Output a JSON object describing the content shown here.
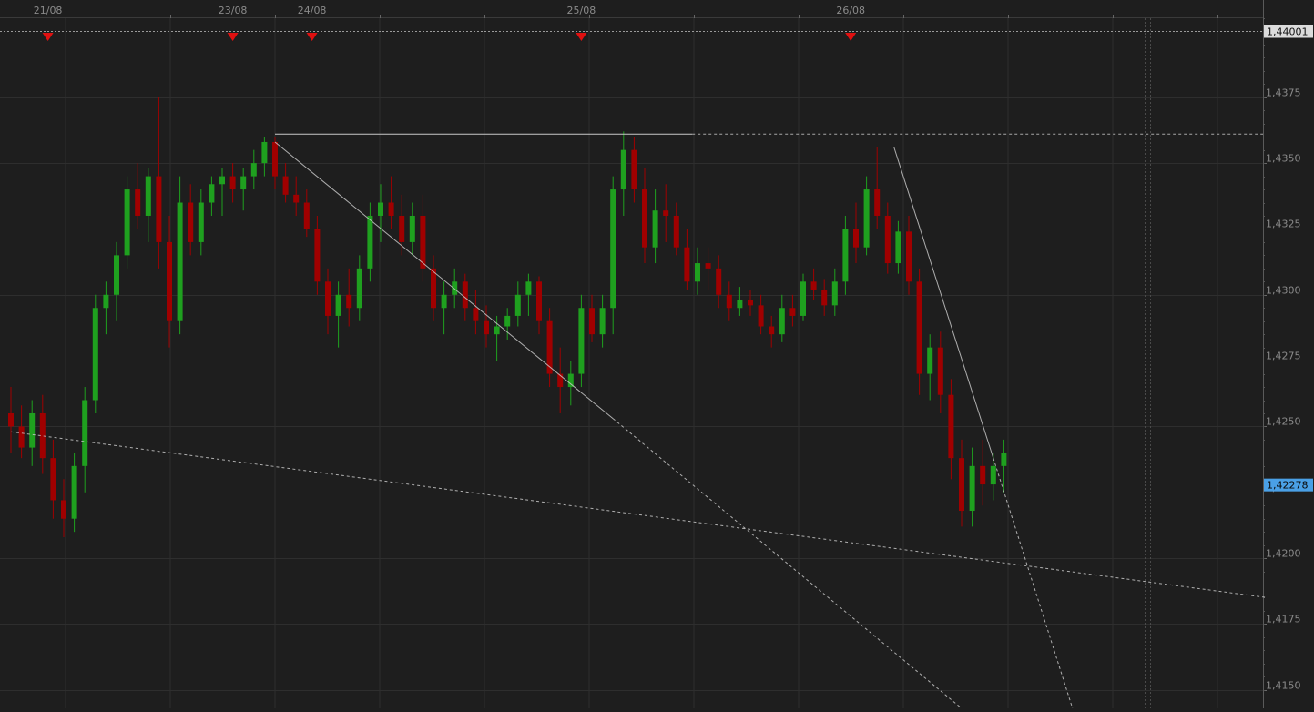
{
  "colors": {
    "background": "#1e1e1e",
    "grid": "#2e2e2e",
    "axis_text": "#8a8a8a",
    "bull_candle": "#1fa01f",
    "bear_candle": "#a00000",
    "trendline": "#c8c8c8",
    "marker": "#e01010",
    "current_price_bg": "#4aa0e6",
    "top_price_bg": "#dcdcdc"
  },
  "chart_data": {
    "type": "candlestick",
    "ylim": [
      1.4143,
      1.4405
    ],
    "xlim": [
      0,
      119
    ],
    "grid": true,
    "y_ticks": [
      {
        "value": 1.4375,
        "label": "1,4375"
      },
      {
        "value": 1.435,
        "label": "1,4350"
      },
      {
        "value": 1.4325,
        "label": "1,4325"
      },
      {
        "value": 1.43,
        "label": "1,4300"
      },
      {
        "value": 1.4275,
        "label": "1,4275"
      },
      {
        "value": 1.425,
        "label": "1,4250"
      },
      {
        "value": 1.4225,
        "label": "1,4225"
      },
      {
        "value": 1.42,
        "label": "1,4200"
      },
      {
        "value": 1.4175,
        "label": "1,4175"
      },
      {
        "value": 1.415,
        "label": "1,4150"
      }
    ],
    "x_ticks": [
      {
        "index": 3.5,
        "label": "21/08"
      },
      {
        "index": 21,
        "label": "23/08"
      },
      {
        "index": 28.5,
        "label": "24/08"
      },
      {
        "index": 54,
        "label": "25/08"
      },
      {
        "index": 79.5,
        "label": "26/08"
      }
    ],
    "markers": [
      3.5,
      21,
      28.5,
      54,
      79.5
    ],
    "top_price": {
      "value": 1.44001,
      "label": "1,44001"
    },
    "current_price": {
      "value": 1.42278,
      "label": "1,42278"
    },
    "resistance": {
      "value": 1.4361,
      "from": 25,
      "solid_to": 64.5
    },
    "trendlines": [
      {
        "style": "dashed",
        "points": [
          [
            0,
            1.4248
          ],
          [
            119,
            1.4185
          ]
        ]
      },
      {
        "style": "solid",
        "points": [
          [
            25,
            1.4358
          ],
          [
            57,
            1.4253
          ]
        ]
      },
      {
        "style": "dashed",
        "points": [
          [
            57,
            1.4253
          ],
          [
            90,
            1.4143
          ]
        ]
      },
      {
        "style": "solid",
        "points": [
          [
            83.6,
            1.4356
          ],
          [
            93,
            1.4238
          ]
        ]
      },
      {
        "style": "dashed",
        "points": [
          [
            93,
            1.4238
          ],
          [
            100.5,
            1.4143
          ]
        ]
      }
    ],
    "candles": [
      [
        1.4255,
        1.4265,
        1.424,
        1.425
      ],
      [
        1.425,
        1.4258,
        1.4238,
        1.4242
      ],
      [
        1.4242,
        1.426,
        1.4235,
        1.4255
      ],
      [
        1.4255,
        1.4262,
        1.4232,
        1.4238
      ],
      [
        1.4238,
        1.4245,
        1.4215,
        1.4222
      ],
      [
        1.4222,
        1.423,
        1.4208,
        1.4215
      ],
      [
        1.4215,
        1.424,
        1.421,
        1.4235
      ],
      [
        1.4235,
        1.4265,
        1.4225,
        1.426
      ],
      [
        1.426,
        1.43,
        1.4255,
        1.4295
      ],
      [
        1.4295,
        1.4305,
        1.4285,
        1.43
      ],
      [
        1.43,
        1.432,
        1.429,
        1.4315
      ],
      [
        1.4315,
        1.4345,
        1.431,
        1.434
      ],
      [
        1.434,
        1.435,
        1.4325,
        1.433
      ],
      [
        1.433,
        1.4348,
        1.432,
        1.4345
      ],
      [
        1.4345,
        1.4375,
        1.431,
        1.432
      ],
      [
        1.432,
        1.433,
        1.428,
        1.429
      ],
      [
        1.429,
        1.4345,
        1.4285,
        1.4335
      ],
      [
        1.4335,
        1.4342,
        1.4315,
        1.432
      ],
      [
        1.432,
        1.434,
        1.4315,
        1.4335
      ],
      [
        1.4335,
        1.4345,
        1.433,
        1.4342
      ],
      [
        1.4342,
        1.4348,
        1.433,
        1.4345
      ],
      [
        1.4345,
        1.435,
        1.4335,
        1.434
      ],
      [
        1.434,
        1.4348,
        1.4332,
        1.4345
      ],
      [
        1.4345,
        1.4355,
        1.434,
        1.435
      ],
      [
        1.435,
        1.436,
        1.4345,
        1.4358
      ],
      [
        1.4358,
        1.436,
        1.434,
        1.4345
      ],
      [
        1.4345,
        1.435,
        1.4335,
        1.4338
      ],
      [
        1.4338,
        1.4345,
        1.433,
        1.4335
      ],
      [
        1.4335,
        1.434,
        1.4322,
        1.4325
      ],
      [
        1.4325,
        1.433,
        1.43,
        1.4305
      ],
      [
        1.4305,
        1.431,
        1.4285,
        1.4292
      ],
      [
        1.4292,
        1.4305,
        1.428,
        1.43
      ],
      [
        1.43,
        1.431,
        1.4288,
        1.4295
      ],
      [
        1.4295,
        1.4315,
        1.429,
        1.431
      ],
      [
        1.431,
        1.4335,
        1.4305,
        1.433
      ],
      [
        1.433,
        1.4342,
        1.432,
        1.4335
      ],
      [
        1.4335,
        1.4345,
        1.4325,
        1.433
      ],
      [
        1.433,
        1.4338,
        1.4315,
        1.432
      ],
      [
        1.432,
        1.4335,
        1.4315,
        1.433
      ],
      [
        1.433,
        1.4338,
        1.4305,
        1.431
      ],
      [
        1.431,
        1.4315,
        1.429,
        1.4295
      ],
      [
        1.4295,
        1.4305,
        1.4285,
        1.43
      ],
      [
        1.43,
        1.431,
        1.4295,
        1.4305
      ],
      [
        1.4305,
        1.4308,
        1.429,
        1.4295
      ],
      [
        1.4295,
        1.4302,
        1.4285,
        1.429
      ],
      [
        1.429,
        1.4296,
        1.428,
        1.4285
      ],
      [
        1.4285,
        1.4292,
        1.4275,
        1.4288
      ],
      [
        1.4288,
        1.4295,
        1.4283,
        1.4292
      ],
      [
        1.4292,
        1.4305,
        1.4288,
        1.43
      ],
      [
        1.43,
        1.4308,
        1.4292,
        1.4305
      ],
      [
        1.4305,
        1.4307,
        1.4285,
        1.429
      ],
      [
        1.429,
        1.4295,
        1.4265,
        1.427
      ],
      [
        1.427,
        1.428,
        1.4255,
        1.4265
      ],
      [
        1.4265,
        1.4275,
        1.4258,
        1.427
      ],
      [
        1.427,
        1.43,
        1.4265,
        1.4295
      ],
      [
        1.4295,
        1.43,
        1.4282,
        1.4285
      ],
      [
        1.4285,
        1.43,
        1.428,
        1.4295
      ],
      [
        1.4295,
        1.4345,
        1.4285,
        1.434
      ],
      [
        1.434,
        1.4362,
        1.433,
        1.4355
      ],
      [
        1.4355,
        1.436,
        1.4335,
        1.434
      ],
      [
        1.434,
        1.4348,
        1.4312,
        1.4318
      ],
      [
        1.4318,
        1.434,
        1.4312,
        1.4332
      ],
      [
        1.4332,
        1.4342,
        1.432,
        1.433
      ],
      [
        1.433,
        1.4335,
        1.4315,
        1.4318
      ],
      [
        1.4318,
        1.4325,
        1.4302,
        1.4305
      ],
      [
        1.4305,
        1.4318,
        1.43,
        1.4312
      ],
      [
        1.4312,
        1.4318,
        1.4302,
        1.431
      ],
      [
        1.431,
        1.4315,
        1.4295,
        1.43
      ],
      [
        1.43,
        1.4305,
        1.429,
        1.4295
      ],
      [
        1.4295,
        1.4303,
        1.4292,
        1.4298
      ],
      [
        1.4298,
        1.4302,
        1.4292,
        1.4296
      ],
      [
        1.4296,
        1.43,
        1.4285,
        1.4288
      ],
      [
        1.4288,
        1.4292,
        1.428,
        1.4285
      ],
      [
        1.4285,
        1.43,
        1.4282,
        1.4295
      ],
      [
        1.4295,
        1.43,
        1.4288,
        1.4292
      ],
      [
        1.4292,
        1.4308,
        1.429,
        1.4305
      ],
      [
        1.4305,
        1.431,
        1.4298,
        1.4302
      ],
      [
        1.4302,
        1.4306,
        1.4292,
        1.4296
      ],
      [
        1.4296,
        1.431,
        1.4292,
        1.4305
      ],
      [
        1.4305,
        1.433,
        1.43,
        1.4325
      ],
      [
        1.4325,
        1.4335,
        1.4312,
        1.4318
      ],
      [
        1.4318,
        1.4345,
        1.4315,
        1.434
      ],
      [
        1.434,
        1.4356,
        1.4325,
        1.433
      ],
      [
        1.433,
        1.4335,
        1.4308,
        1.4312
      ],
      [
        1.4312,
        1.4328,
        1.4308,
        1.4324
      ],
      [
        1.4324,
        1.433,
        1.43,
        1.4305
      ],
      [
        1.4305,
        1.431,
        1.4262,
        1.427
      ],
      [
        1.427,
        1.4285,
        1.426,
        1.428
      ],
      [
        1.428,
        1.4286,
        1.4255,
        1.4262
      ],
      [
        1.4262,
        1.4268,
        1.423,
        1.4238
      ],
      [
        1.4238,
        1.4245,
        1.4212,
        1.4218
      ],
      [
        1.4218,
        1.4242,
        1.4212,
        1.4235
      ],
      [
        1.4235,
        1.4245,
        1.422,
        1.4228
      ],
      [
        1.4228,
        1.424,
        1.4222,
        1.4235
      ],
      [
        1.4235,
        1.4245,
        1.4225,
        1.424
      ]
    ]
  }
}
